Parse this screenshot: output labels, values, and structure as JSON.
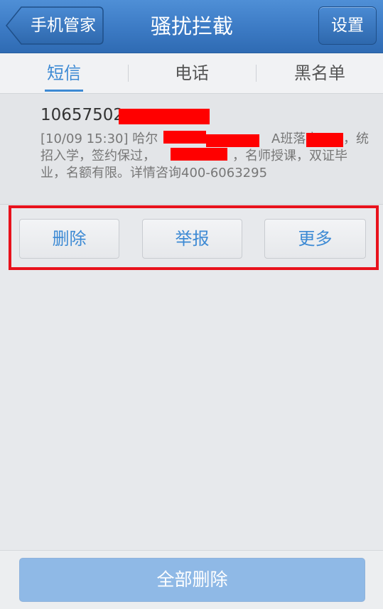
{
  "header": {
    "back_label": "手机管家",
    "title": "骚扰拦截",
    "settings_label": "设置"
  },
  "tabs": [
    {
      "label": "短信",
      "active": true
    },
    {
      "label": "电话",
      "active": false
    },
    {
      "label": "黑名单",
      "active": false
    }
  ],
  "message": {
    "sender_prefix": "10657502",
    "line1_a": "[10/09 15:30]  哈尔",
    "line1_b": "A班落户",
    "line1_c": "，统",
    "line2_a": "招入学，签约保过，",
    "line2_b": "，名师授课，双证毕",
    "line3": "业，名额有限。详情咨询400-6063295"
  },
  "actions": {
    "delete_label": "删除",
    "report_label": "举报",
    "more_label": "更多"
  },
  "bottom": {
    "delete_all_label": "全部删除"
  },
  "colors": {
    "header_blue": "#3d7cc6",
    "accent": "#3d8ad4",
    "highlight_red": "#e8121c",
    "redaction_red": "#ff0000"
  }
}
